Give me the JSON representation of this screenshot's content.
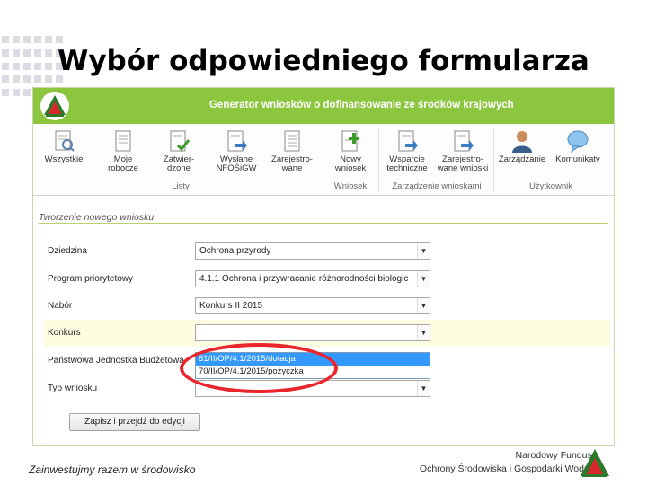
{
  "slide": {
    "title": "Wybór odpowiedniego formularza",
    "slogan": "Zainwestujmy razem w środowisko",
    "fund_line1": "Narodowy Fundusz",
    "fund_line2": "Ochrony Środowiska i Gospodarki Wodnej"
  },
  "app": {
    "title": "Generator wniosków o dofinansowanie ze środków krajowych",
    "accent": "#8cc63f"
  },
  "ribbon": {
    "buttons": [
      {
        "label1": "Wszystkie",
        "label2": "",
        "icon": "document-search-icon"
      },
      {
        "label1": "Moje",
        "label2": "robocze",
        "icon": "document-icon"
      },
      {
        "label1": "Zatwier-",
        "label2": "dzone",
        "icon": "document-check-icon"
      },
      {
        "label1": "Wysłane",
        "label2": "NFOŚiGW",
        "icon": "document-send-icon"
      },
      {
        "label1": "Zarejestro-",
        "label2": "wane",
        "icon": "document-list-icon"
      },
      {
        "label1": "Nowy",
        "label2": "wniosek",
        "icon": "document-add-icon"
      },
      {
        "label1": "Wsparcie",
        "label2": "techniczne",
        "icon": "document-send-icon"
      },
      {
        "label1": "Zarejestro-",
        "label2": "wane wnioski",
        "icon": "document-send-icon"
      },
      {
        "label1": "Zarządzanie",
        "label2": "",
        "icon": "user-icon"
      },
      {
        "label1": "Komunikaty",
        "label2": "",
        "icon": "speech-bubble-icon"
      }
    ],
    "groups": {
      "listy": "Listy",
      "wniosek": "Wniosek",
      "zarzadzanie": "Zarządzenie wnioskami",
      "uzytkownik": "Użytkownik"
    }
  },
  "form": {
    "section_title": "Tworzenie nowego wniosku",
    "fields": [
      {
        "label": "Dziedzina",
        "value": "Ochrona przyrody"
      },
      {
        "label": "Program priorytetowy",
        "value": "4.1.1 Ochrona i przywracanie różnorodności biologic"
      },
      {
        "label": "Nabór",
        "value": "Konkurs II 2015"
      },
      {
        "label": "Konkurs",
        "value": ""
      },
      {
        "label": "Państwowa Jednostka Budżetowa",
        "value": ""
      },
      {
        "label": "Typ wniosku",
        "value": ""
      }
    ],
    "dropdown_options": [
      "61/II/OP/4.1/2015/dotacja",
      "70/II/OP/4.1/2015/pożyczka"
    ],
    "save_label": "Zapisz i przejdź do edycji"
  }
}
